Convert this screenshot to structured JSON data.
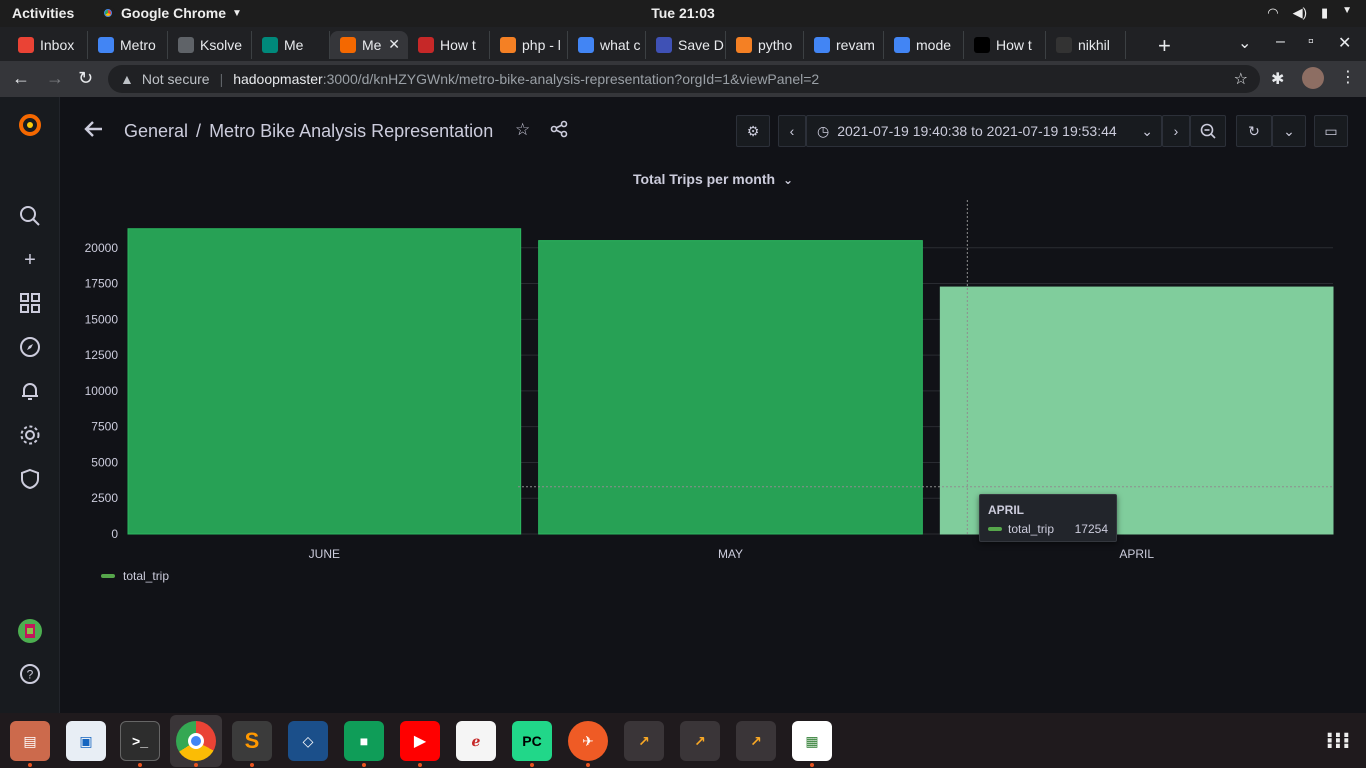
{
  "system_bar": {
    "activities": "Activities",
    "app_name": "Google Chrome",
    "clock": "Tue 21:03"
  },
  "browser": {
    "tabs": [
      {
        "label": "Inbox",
        "icon": "gmail-icon",
        "color": "#ea4335"
      },
      {
        "label": "Metro",
        "icon": "docs-icon",
        "color": "#4285f4"
      },
      {
        "label": "Ksolve",
        "icon": "globe-icon",
        "color": "#5f6368"
      },
      {
        "label": "Me",
        "icon": "meet-icon",
        "color": "#00897b"
      },
      {
        "label": "Me",
        "icon": "grafana-icon",
        "color": "#f46800",
        "active": true
      },
      {
        "label": "How t",
        "icon": "redline-icon",
        "color": "#c62828"
      },
      {
        "label": "php - l",
        "icon": "stackoverflow-icon",
        "color": "#f48024"
      },
      {
        "label": "what c",
        "icon": "google-icon",
        "color": "#4285f4"
      },
      {
        "label": "Save D",
        "icon": "k-icon",
        "color": "#3f51b5"
      },
      {
        "label": "pytho",
        "icon": "stackoverflow-icon",
        "color": "#f48024"
      },
      {
        "label": "revam",
        "icon": "google-icon",
        "color": "#4285f4"
      },
      {
        "label": "mode",
        "icon": "google-icon",
        "color": "#4285f4"
      },
      {
        "label": "How t",
        "icon": "medium-icon",
        "color": "#000000"
      },
      {
        "label": "nikhil",
        "icon": "github-icon",
        "color": "#333333"
      }
    ],
    "security_label": "Not secure",
    "url_host": "hadoopmaster",
    "url_path": ":3000/d/knHZYGWnk/metro-bike-analysis-representation?orgId=1&viewPanel=2"
  },
  "grafana": {
    "breadcrumb_folder": "General",
    "breadcrumb_separator": "/",
    "dashboard_title": "Metro Bike Analysis Representation",
    "time_range": "2021-07-19 19:40:38 to 2021-07-19 19:53:44",
    "panel_title": "Total Trips per month",
    "legend_label": "total_trip",
    "tooltip": {
      "title": "APRIL",
      "series": "total_trip",
      "value": "17254"
    }
  },
  "chart_data": {
    "type": "bar",
    "title": "Total Trips per month",
    "categories": [
      "JUNE",
      "MAY",
      "APRIL"
    ],
    "series": [
      {
        "name": "total_trip",
        "values": [
          21330,
          20500,
          17254
        ]
      }
    ],
    "ylim": [
      0,
      22500
    ],
    "yticks": [
      0,
      2500,
      5000,
      7500,
      10000,
      12500,
      15000,
      17500,
      20000
    ],
    "hovered_category": "APRIL",
    "bar_color": "#27a155",
    "hover_color": "#80cd9c",
    "grid": true,
    "legend_position": "bottom-left"
  }
}
